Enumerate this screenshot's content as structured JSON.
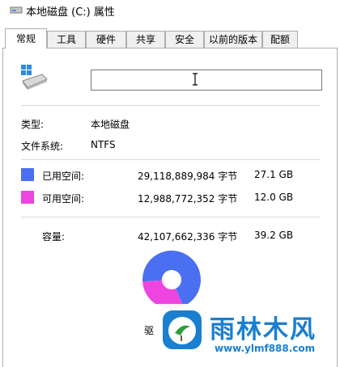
{
  "window": {
    "title": "本地磁盘 (C:) 属性"
  },
  "tabs": [
    {
      "label": "常规"
    },
    {
      "label": "工具"
    },
    {
      "label": "硬件"
    },
    {
      "label": "共享"
    },
    {
      "label": "安全"
    },
    {
      "label": "以前的版本"
    },
    {
      "label": "配额"
    }
  ],
  "active_tab": "常规",
  "general": {
    "name_value": "",
    "type_label": "类型:",
    "type_value": "本地磁盘",
    "fs_label": "文件系统:",
    "fs_value": "NTFS",
    "used": {
      "label": "已用空间:",
      "bytes": "29,118,889,984 字节",
      "size": "27.1 GB",
      "color": "#4a6ff0"
    },
    "free": {
      "label": "可用空间:",
      "bytes": "12,988,772,352 字节",
      "size": "12.0 GB",
      "color": "#ee44e0"
    },
    "capacity": {
      "label": "容量:",
      "bytes": "42,107,662,336 字节",
      "size": "39.2 GB"
    },
    "bottom_fragment": "驱"
  },
  "chart_data": {
    "type": "pie",
    "categories": [
      "已用空间",
      "可用空间"
    ],
    "values": [
      27.1,
      12.0
    ],
    "colors": [
      "#4a6ff0",
      "#ee44e0"
    ]
  },
  "watermark": {
    "title": "雨林木风",
    "url": "www.ylmf888.com",
    "color": "#1a7fd0"
  }
}
